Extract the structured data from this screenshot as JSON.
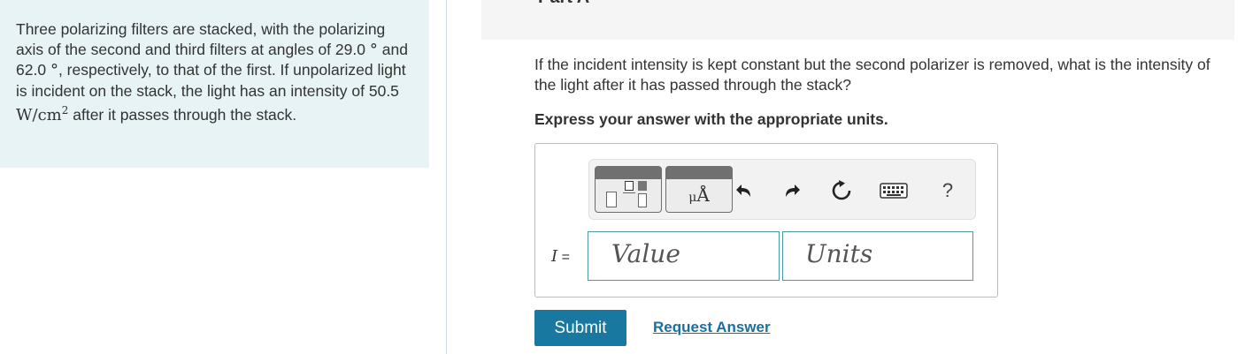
{
  "problem": {
    "intro": "Three polarizing filters are stacked, with the polarizing axis of the second and third filters at angles of",
    "angle1_value": "29.0",
    "angle_unit": "°",
    "and_text": "and",
    "angle2_value": "62.0",
    "respectively_text": ", respectively, to that of the first. If unpolarized light is incident on the stack, the light has an intensity of",
    "intensity_value": "50.5",
    "intensity_unit_base": "W/cm",
    "intensity_unit_exp": "2",
    "outro": "after it passes through the stack."
  },
  "part": {
    "title": "Part A"
  },
  "question": {
    "text": "If the incident intensity is kept constant but the second polarizer is removed, what is the intensity of the light after it has passed through the stack?",
    "instruction": "Express your answer with the appropriate units."
  },
  "toolbar": {
    "symbols_mu": "μ",
    "symbols_A": "Å",
    "help": "?"
  },
  "answer": {
    "variable": "I",
    "equals": " =",
    "value_placeholder": "Value",
    "units_placeholder": "Units"
  },
  "actions": {
    "submit_label": "Submit",
    "request_label": "Request Answer"
  },
  "colors": {
    "panel_bg": "#e7f3f5",
    "accent": "#1878a0",
    "link": "#1a6fa2",
    "field_border": "#4a9aa6"
  }
}
